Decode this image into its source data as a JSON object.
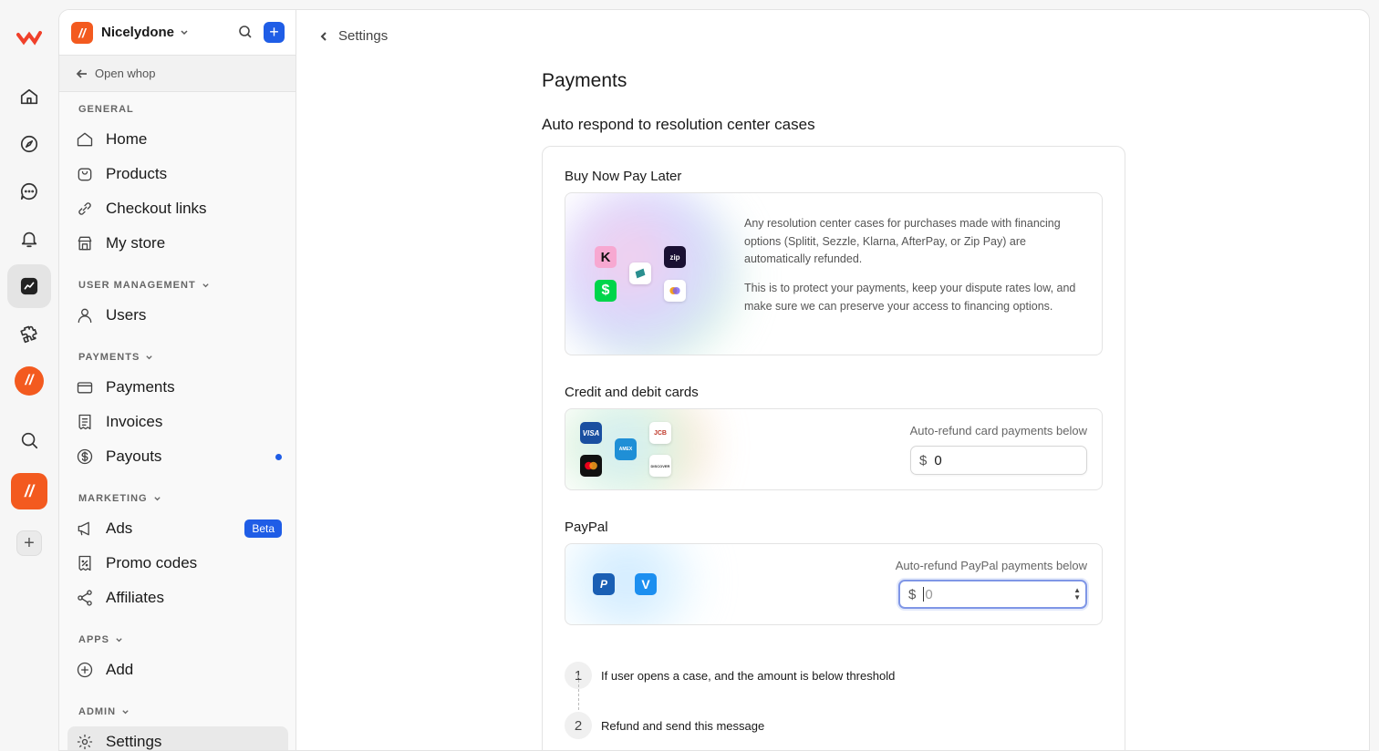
{
  "workspace": {
    "name": "Nicelydone",
    "open_whop": "Open whop"
  },
  "header": {
    "back_label": "Settings"
  },
  "sidebar": {
    "sections": {
      "general": "GENERAL",
      "user_management": "USER MANAGEMENT",
      "payments": "PAYMENTS",
      "marketing": "MARKETING",
      "apps": "APPS",
      "admin": "ADMIN"
    },
    "items": {
      "home": "Home",
      "products": "Products",
      "checkout_links": "Checkout links",
      "my_store": "My store",
      "users": "Users",
      "payments": "Payments",
      "invoices": "Invoices",
      "payouts": "Payouts",
      "ads": "Ads",
      "ads_badge": "Beta",
      "promo_codes": "Promo codes",
      "affiliates": "Affiliates",
      "add": "Add",
      "settings": "Settings"
    }
  },
  "page": {
    "title": "Payments",
    "subtitle": "Auto respond to resolution center cases",
    "bnpl": {
      "label": "Buy Now Pay Later",
      "text1": "Any resolution center cases for purchases made with financing options (Splitit, Sezzle, Klarna, AfterPay, or Zip Pay) are automatically refunded.",
      "text2": "This is to protect your payments, keep your dispute rates low, and make sure we can preserve your access to financing options.",
      "logos": {
        "klarna": "K",
        "zip": "zip",
        "cashapp": "$"
      }
    },
    "cards": {
      "label": "Credit and debit cards",
      "field_label": "Auto-refund card payments below",
      "currency": "$",
      "value": "0",
      "logos": {
        "visa": "VISA",
        "jcb": "JCB",
        "amex": "AMEX",
        "discover": "DISCOVER"
      }
    },
    "paypal": {
      "label": "PayPal",
      "field_label": "Auto-refund PayPal payments below",
      "currency": "$",
      "placeholder": "0",
      "logos": {
        "paypal": "P",
        "venmo": "V"
      }
    },
    "steps": [
      {
        "num": "1",
        "text": "If user opens a case, and the amount is below threshold"
      },
      {
        "num": "2",
        "text": "Refund and send this message"
      }
    ]
  },
  "colors": {
    "accent": "#1f5de6",
    "brand": "#f35a1f"
  }
}
